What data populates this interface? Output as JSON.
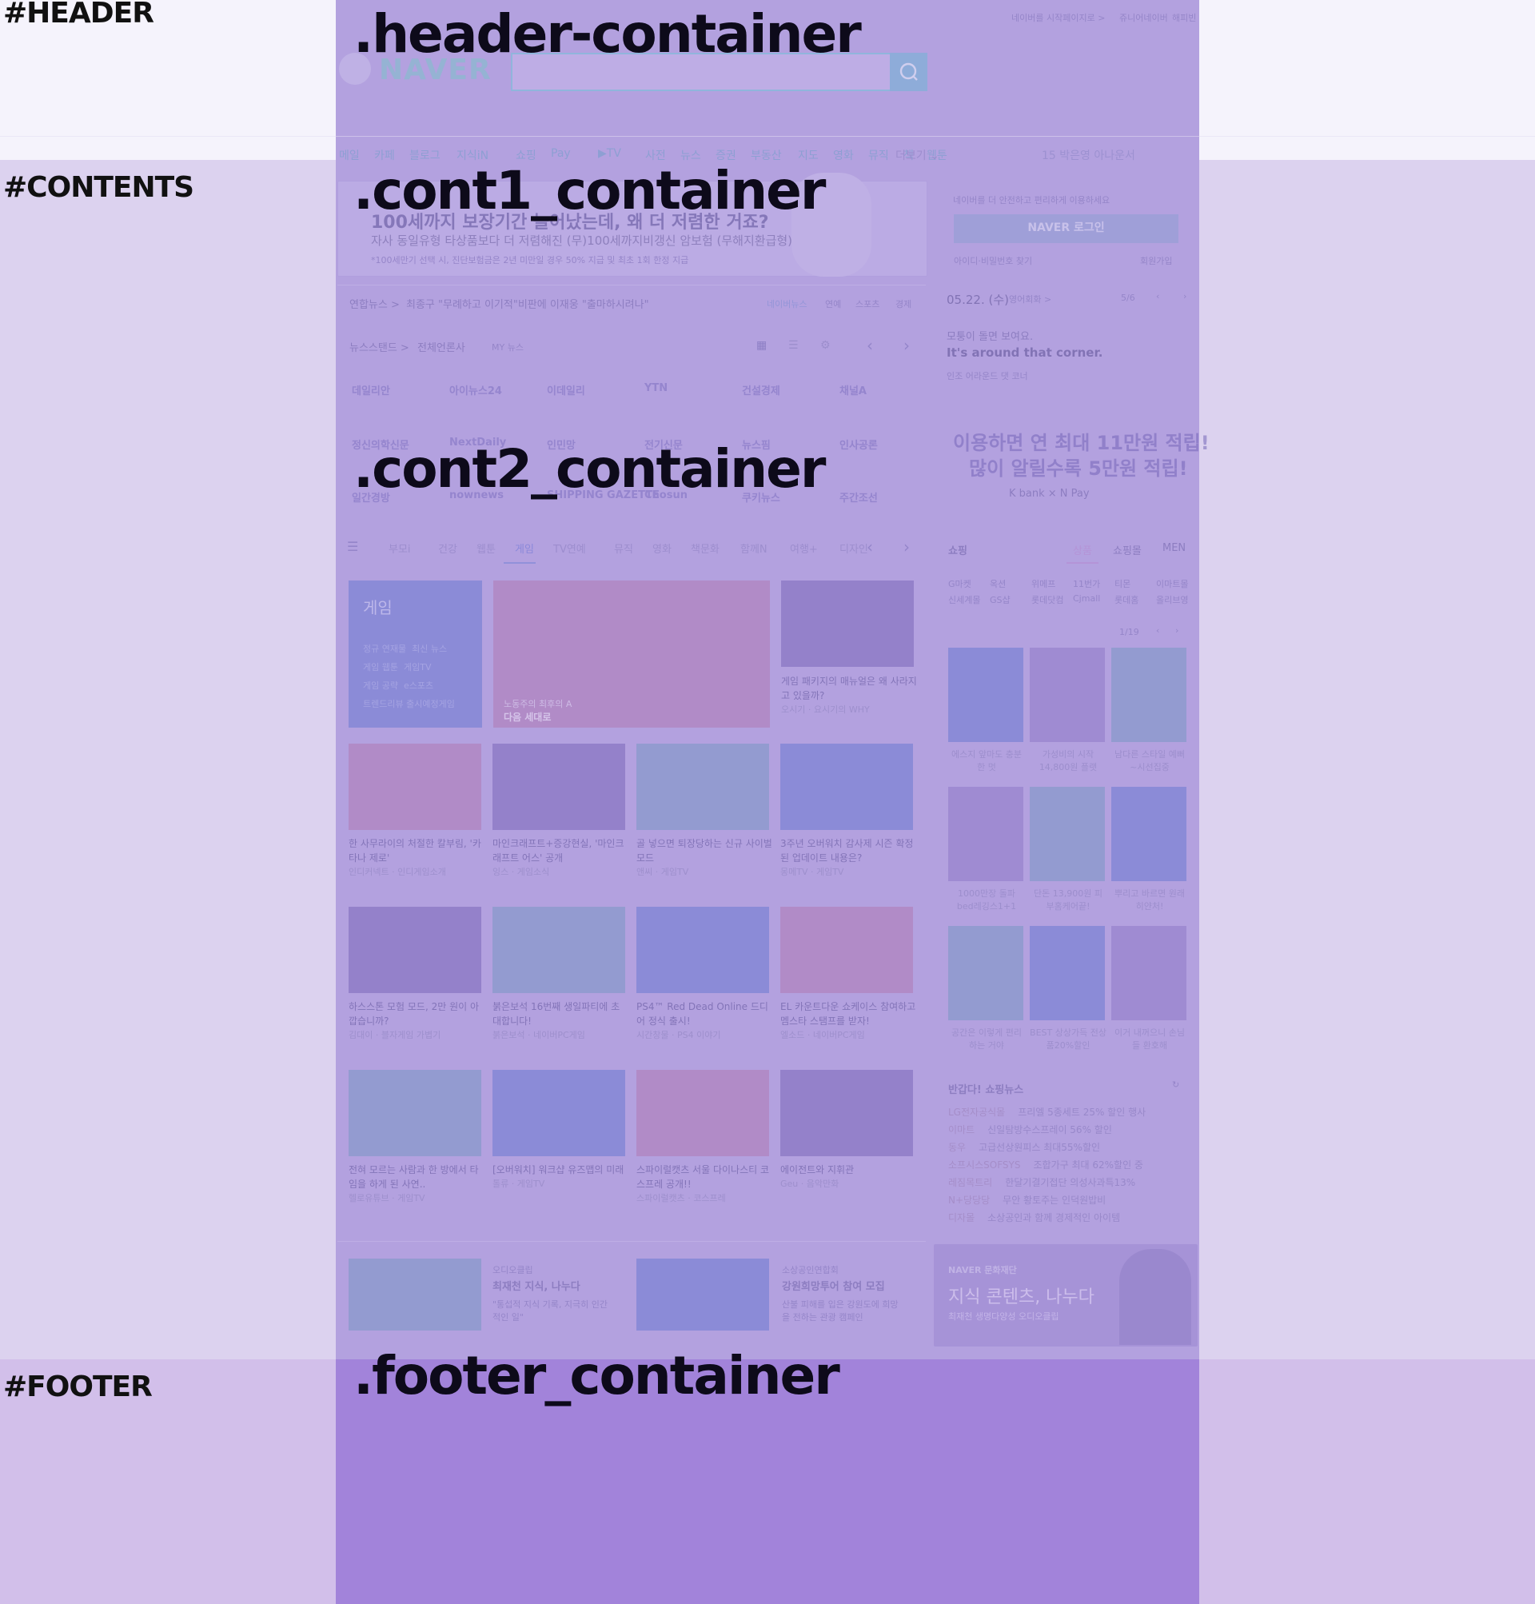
{
  "overlay_labels": {
    "header": "#HEADER",
    "contents": "#CONTENTS",
    "footer": "#FOOTER",
    "header_container": ".header-container",
    "cont1_container": ".cont1_container",
    "cont2_container": ".cont2_container",
    "footer_container": ".footer_container"
  },
  "header": {
    "top_links": [
      "네이버를 시작페이지로 >",
      "쥬니어네이버",
      "해피빈"
    ],
    "logo": "NAVER",
    "nav": [
      "메일",
      "카페",
      "블로그",
      "지식iN",
      "쇼핑",
      "Pay",
      "▶TV",
      "사전",
      "뉴스",
      "증권",
      "부동산",
      "지도",
      "영화",
      "뮤직",
      "책",
      "웹툰"
    ],
    "more": "더보기",
    "ticker": "15 박은영 아나운서"
  },
  "banner": {
    "title": "100세까지 보장기간 늘어났는데, 왜 더 저렴한 거죠?",
    "sub": "자사 동일유형 타상품보다 더 저렴해진 (무)100세까지비갱신 암보험 (무해지환급형)",
    "note": "*100세만기 선택 시, 진단보험금은 2년 미만일 경우 50% 지급 및 최초 1회 한정 지급"
  },
  "login": {
    "hint": "네이버를 더 안전하고 편리하게 이용하세요",
    "button": "NAVER 로그인",
    "find": "아이디·비밀번호 찾기",
    "signup": "회원가입"
  },
  "newsbar": {
    "source": "연합뉴스 >",
    "headline": "최종구 \"무례하고 이기적\"비판에 이재웅 \"출마하시려나\"",
    "tabs": [
      "네이버뉴스",
      "연예",
      "스포츠",
      "경제"
    ]
  },
  "newsstand": {
    "title": "뉴스스탠드 >",
    "all": "전체언론사",
    "my": "MY 뉴스",
    "row1": [
      "데일리안",
      "아이뉴스24",
      "이데일리",
      "YTN",
      "건설경제",
      "채널A"
    ],
    "row2": [
      "정신의학신문",
      "NextDaily",
      "인민망",
      "전기신문",
      "뉴스핌",
      "인사공론"
    ],
    "row3": [
      "일간경방",
      "nownews",
      "SHIPPING GAZETTE",
      "Chosun",
      "쿠키뉴스",
      "주간조선"
    ]
  },
  "date_widget": {
    "date": "05.22. (수)",
    "sub": "영어회화 >",
    "page": "5/6",
    "line1": "모퉁이 돌면 보여요.",
    "line2": "It's around that corner.",
    "line3": "인조 어라운드 댓 코너"
  },
  "ad": {
    "line1": "이용하면 연 최대 11만원 적립!",
    "line2": "많이 알릴수록 5만원 적립!",
    "brand": "K bank × N Pay"
  },
  "category_tabs": [
    "부모i",
    "건강",
    "웹툰",
    "게임",
    "TV연예",
    "뮤직",
    "영화",
    "책문화",
    "함께N",
    "여행+",
    "디자인"
  ],
  "game_panel": {
    "title": "게임",
    "links": [
      "정규 연재물",
      "최신 뉴스",
      "게임 웹툰",
      "게임TV",
      "게임 공략",
      "e스포츠",
      "트렌드리뷰",
      "출시예정게임"
    ]
  },
  "featured": {
    "caption1": "노동주의 최후의 A",
    "caption2": "다음 세대로",
    "side_title": "게임 패키지의 매뉴얼은 왜 사라지고 있을까?",
    "side_src": "오시기 · 요시기의 WHY"
  },
  "cards": [
    {
      "title": "한 사무라이의 처절한 칼부림, '카타나 제로'",
      "src": "인디커넥트 · 인디게임소개"
    },
    {
      "title": "마인크래프트+증강현실, '마인크래프트 어스' 공개",
      "src": "잉스 · 게임소식"
    },
    {
      "title": "골 넣으면 퇴장당하는 신규 사이벌 모드",
      "src": "앤씨 · 게임TV"
    },
    {
      "title": "3주년 오버워치 감사제 시즌 확정된 업데이트 내용은?",
      "src": "몽메TV · 게임TV"
    },
    {
      "title": "하스스톤 모험 모드, 2만 원이 아깝습니까?",
      "src": "김대이 · 블자게임 가볍기"
    },
    {
      "title": "붉은보석 16번째 생일파티에 초대합니다!",
      "src": "붉은보석 · 네이버PC게임"
    },
    {
      "title": "PS4™ Red Dead Online 드디어 정식 출시!",
      "src": "시간창물 · PS4 이야기"
    },
    {
      "title": "EL 카운트다운 쇼케이스 참여하고 멤스타 스탬프를 받자!",
      "src": "엘소드 · 네이버PC게임"
    },
    {
      "title": "전혀 모르는 사람과 한 방에서 타임을 하게 된 사연..",
      "src": "헬로유튜브 · 게임TV"
    },
    {
      "title": "[오버워치] 워크샵 유즈맵의 미래",
      "src": "톨류 · 게임TV"
    },
    {
      "title": "스파이럴캣츠 서울 다이나스티 코스프레 공개!!",
      "src": "스파이럴캣츠 · 코스프레"
    },
    {
      "title": "에이전트와 지휘관",
      "src": "Geu · 음악만화"
    }
  ],
  "shopping": {
    "title": "쇼핑",
    "tabs": [
      "상품",
      "쇼핑몰",
      "MEN"
    ],
    "malls_row1": [
      "G마켓",
      "옥션",
      "위메프",
      "11번가",
      "티몬",
      "이마트몰"
    ],
    "malls_row2": [
      "신세계몰",
      "GS샵",
      "롯데닷컴",
      "Cjmall",
      "롯데홈",
      "올리브영"
    ],
    "page": "1/19",
    "items": [
      "에스지 앞마도 충분한 멋",
      "가성비의 시작 14,800원 플랫",
      "남다른 스타일 예뻐~시선집중",
      "1000만장 돌파 bed레깅스1+1",
      "단돈 13,900원 피부홈케어끝!",
      "뿌리고 바르면 원래 히얀처!",
      "공간은 이렇게 편리하는 거야",
      "BEST 상상가득 전상품20%할인",
      "이거 내꺼으니 손님들 환호해"
    ],
    "news_title": "반갑다! 쇼핑뉴스",
    "news": [
      {
        "src": "LG전자공식몰",
        "text": "프리엘 5종세트 25% 할인 행사"
      },
      {
        "src": "이마트",
        "text": "신일탐방수스프레이 56% 할인"
      },
      {
        "src": "동우",
        "text": "고급선상원피스 최대55%할인"
      },
      {
        "src": "소프시스SOFSYS",
        "text": "조합가구 최대 62%할인 중"
      },
      {
        "src": "레짐목트리",
        "text": "한달기결기접단 의성사과특13%"
      },
      {
        "src": "N+당당당",
        "text": "무안 황토주는 인덕원밥비"
      },
      {
        "src": "디자몰",
        "text": "소상공인과 함께 경제적인 아이템"
      }
    ]
  },
  "bottom_promos": [
    {
      "tag": "오디오클립",
      "title": "최재천 지식, 나누다",
      "desc": "\"통섭적 지식 기록, 지극히 인간적인 일\""
    },
    {
      "tag": "소상공인연합회",
      "title": "강원희망투어 참여 모집",
      "desc": "산불 피해를 입은 강원도에 희망을 전하는 관광 캠페인"
    }
  ],
  "culture_banner": {
    "brand": "NAVER 문화재단",
    "title": "지식 콘텐츠, 나누다",
    "sub": "최재천 생명다양성 오디오클립"
  },
  "colors": {
    "overlay_center": "#b3a1df",
    "overlay_footer": "#a283da",
    "brand": "#7cc3c9"
  }
}
